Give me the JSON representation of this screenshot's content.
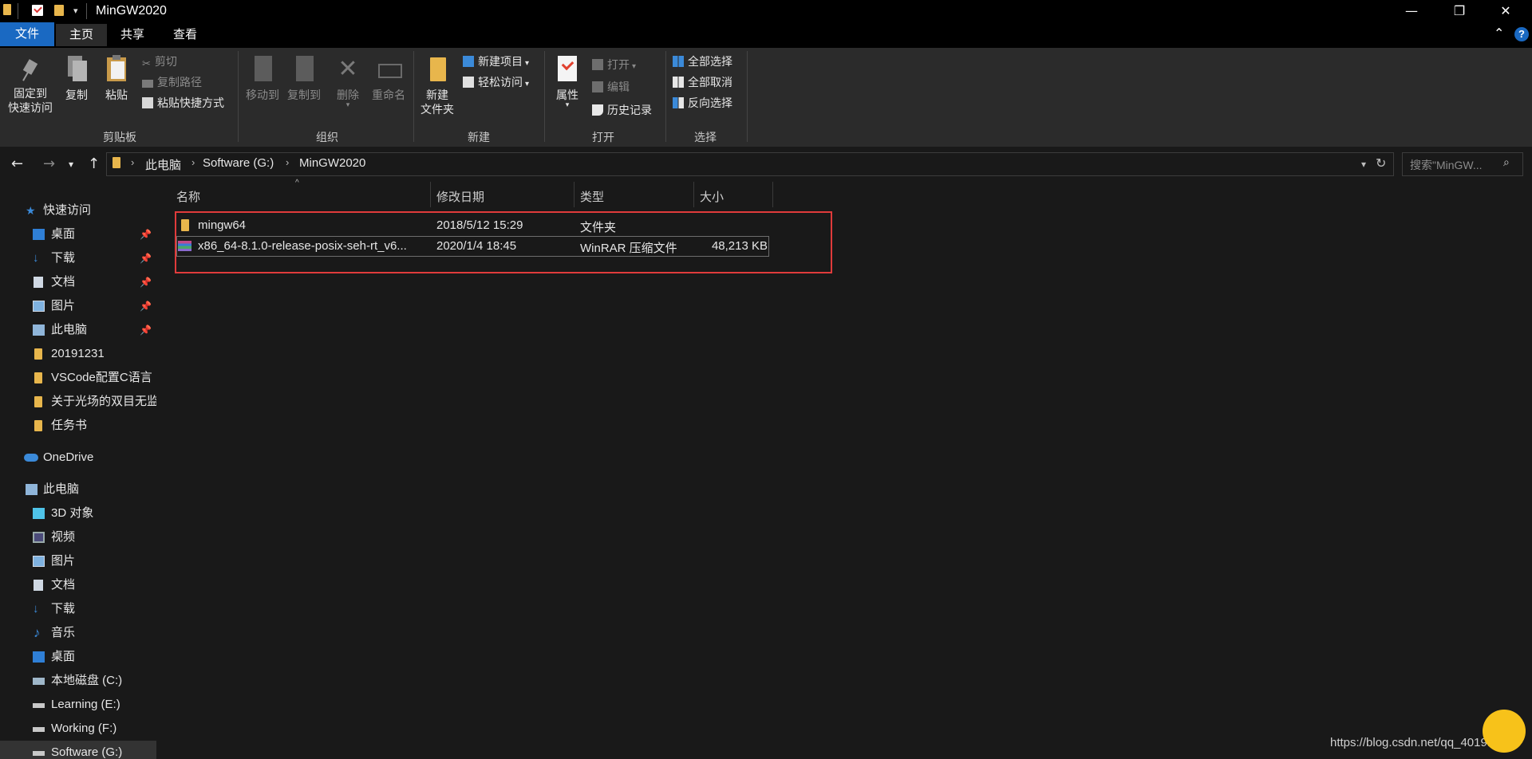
{
  "window": {
    "title": "MinGW2020",
    "controls": {
      "minimize": "—",
      "restore": "❐",
      "close": "✕"
    }
  },
  "menu_tabs": {
    "file": "文件",
    "home": "主页",
    "share": "共享",
    "view": "查看"
  },
  "ribbon": {
    "clipboard": {
      "pin_line1": "固定到",
      "pin_line2": "快速访问",
      "copy": "复制",
      "paste": "粘贴",
      "cut": "剪切",
      "copy_path": "复制路径",
      "paste_shortcut": "粘贴快捷方式",
      "group": "剪贴板"
    },
    "organize": {
      "move_to": "移动到",
      "copy_to": "复制到",
      "delete": "删除",
      "rename": "重命名",
      "group": "组织"
    },
    "new": {
      "new_folder_line1": "新建",
      "new_folder_line2": "文件夹",
      "new_item": "新建项目",
      "easy_access": "轻松访问",
      "group": "新建"
    },
    "open": {
      "properties": "属性",
      "open": "打开",
      "edit": "编辑",
      "history": "历史记录",
      "group": "打开"
    },
    "select": {
      "select_all": "全部选择",
      "select_none": "全部取消",
      "invert": "反向选择",
      "group": "选择"
    }
  },
  "address": {
    "crumbs": [
      "此电脑",
      "Software (G:)",
      "MinGW2020"
    ],
    "search_placeholder": "搜索\"MinGW..."
  },
  "nav_pane": {
    "quick_access": "快速访问",
    "quick_items": [
      "桌面",
      "下载",
      "文档",
      "图片",
      "此电脑",
      "20191231",
      "VSCode配置C语言",
      "关于光场的双目无监",
      "任务书"
    ],
    "onedrive": "OneDrive",
    "this_pc": "此电脑",
    "pc_items": [
      "3D 对象",
      "视频",
      "图片",
      "文档",
      "下载",
      "音乐",
      "桌面",
      "本地磁盘 (C:)",
      "Learning (E:)",
      "Working (F:)",
      "Software (G:)"
    ]
  },
  "file_list": {
    "columns": [
      "名称",
      "修改日期",
      "类型",
      "大小"
    ],
    "rows": [
      {
        "name": "mingw64",
        "date": "2018/5/12 15:29",
        "type": "文件夹",
        "size": ""
      },
      {
        "name": "x86_64-8.1.0-release-posix-seh-rt_v6...",
        "date": "2020/1/4 18:45",
        "type": "WinRAR 压缩文件",
        "size": "48,213 KB"
      }
    ]
  },
  "watermark": "https://blog.csdn.net/qq_4019...",
  "colors": {
    "accent": "#1a69c2",
    "highlight_box": "#e03b3b",
    "folder": "#e8b64c"
  }
}
